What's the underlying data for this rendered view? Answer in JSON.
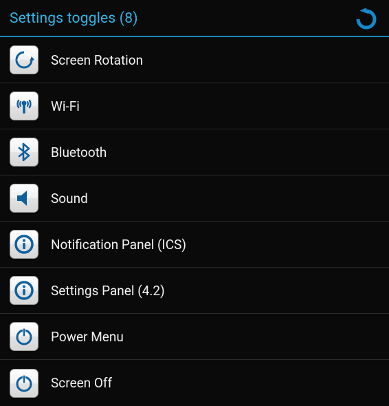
{
  "header": {
    "title": "Settings toggles (8)"
  },
  "toggles": [
    {
      "icon": "rotation-icon",
      "label": "Screen Rotation"
    },
    {
      "icon": "wifi-icon",
      "label": "Wi-Fi"
    },
    {
      "icon": "bluetooth-icon",
      "label": "Bluetooth"
    },
    {
      "icon": "sound-icon",
      "label": "Sound"
    },
    {
      "icon": "info-icon",
      "label": "Notification Panel (ICS)"
    },
    {
      "icon": "info-icon",
      "label": "Settings Panel (4.2)"
    },
    {
      "icon": "power-icon",
      "label": "Power Menu"
    },
    {
      "icon": "power-icon",
      "label": "Screen Off"
    }
  ],
  "colors": {
    "accent": "#33b5e5",
    "icon_primary": "#0d5f9e"
  }
}
